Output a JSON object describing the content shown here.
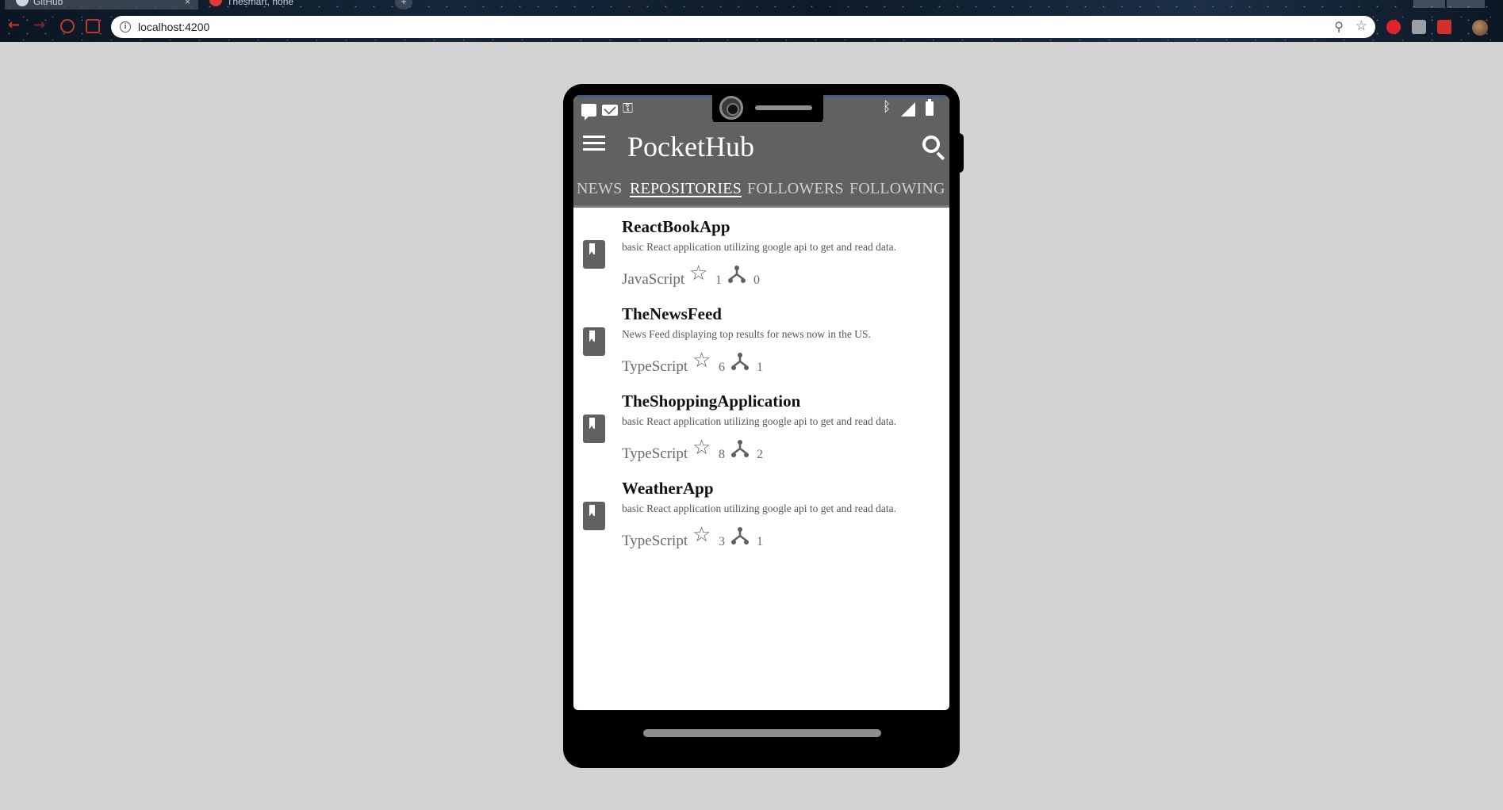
{
  "browser": {
    "tabs": [
      {
        "label": "GitHub"
      },
      {
        "label": "Thesmart, hone"
      }
    ],
    "url": "localhost:4200"
  },
  "app": {
    "title": "PocketHub",
    "tabs": [
      {
        "label": "NEWS",
        "active": false
      },
      {
        "label": "REPOSITORIES",
        "active": true
      },
      {
        "label": "FOLLOWERS",
        "active": false
      },
      {
        "label": "FOLLOWING",
        "active": false
      }
    ],
    "repos": [
      {
        "name": "ReactBookApp",
        "description": "basic React application utilizing google api to get and read data.",
        "language": "JavaScript",
        "stars": "1",
        "forks": "0"
      },
      {
        "name": "TheNewsFeed",
        "description": "News Feed displaying top results for news now in the US.",
        "language": "TypeScript",
        "stars": "6",
        "forks": "1"
      },
      {
        "name": "TheShoppingApplication",
        "description": "basic React application utilizing google api to get and read data.",
        "language": "TypeScript",
        "stars": "8",
        "forks": "2"
      },
      {
        "name": "WeatherApp",
        "description": "basic React application utilizing google api to get and read data.",
        "language": "TypeScript",
        "stars": "3",
        "forks": "1"
      }
    ]
  },
  "icons": {
    "menu": "hamburger-icon",
    "search": "search-icon",
    "repo": "repo-bookmark-icon",
    "star": "star-icon",
    "fork": "fork-icon"
  },
  "colors": {
    "app_bar": "#616161",
    "background": "#d3d3d3",
    "phone": "#000000"
  }
}
